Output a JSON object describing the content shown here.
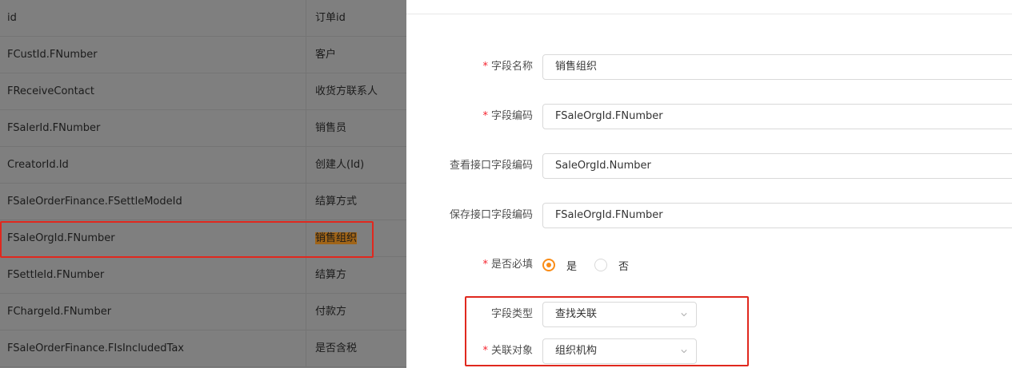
{
  "table": {
    "rows": [
      {
        "id": "id",
        "name": "订单id"
      },
      {
        "id": "FCustId.FNumber",
        "name": "客户"
      },
      {
        "id": "FReceiveContact",
        "name": "收货方联系人"
      },
      {
        "id": "FSalerId.FNumber",
        "name": "销售员"
      },
      {
        "id": "CreatorId.Id",
        "name": "创建人(Id)"
      },
      {
        "id": "FSaleOrderFinance.FSettleModeId",
        "name": "结算方式"
      },
      {
        "id": "FSaleOrgId.FNumber",
        "name": "销售组织"
      },
      {
        "id": "FSettleId.FNumber",
        "name": "结算方"
      },
      {
        "id": "FChargeId.FNumber",
        "name": "付款方"
      },
      {
        "id": "FSaleOrderFinance.FIsIncludedTax",
        "name": "是否含税"
      }
    ]
  },
  "form": {
    "required_mark": "*",
    "field_name": {
      "label": "字段名称",
      "value": "销售组织"
    },
    "field_code": {
      "label": "字段编码",
      "value": "FSaleOrgId.FNumber"
    },
    "query_code": {
      "label": "查看接口字段编码",
      "value": "SaleOrgId.Number"
    },
    "save_code": {
      "label": "保存接口字段编码",
      "value": "FSaleOrgId.FNumber"
    },
    "required": {
      "label": "是否必填",
      "yes": "是",
      "no": "否",
      "selected": "是"
    },
    "field_type": {
      "label": "字段类型",
      "value": "查找关联"
    },
    "related_object": {
      "label": "关联对象",
      "value": "组织机构"
    }
  },
  "colors": {
    "accent": "#fa8c16",
    "required": "#f5222d",
    "highlight_box": "#e0281e"
  }
}
